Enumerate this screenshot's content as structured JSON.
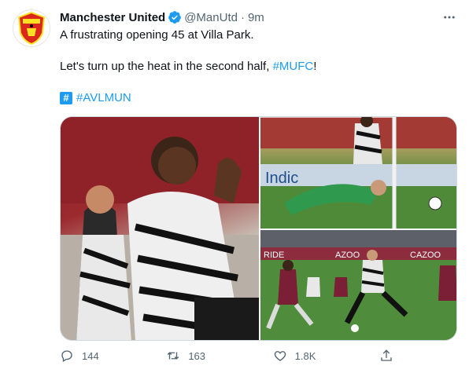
{
  "tweet": {
    "author_name": "Manchester United",
    "handle": "@ManUtd",
    "separator": "·",
    "time": "9m",
    "lines": [
      "A frustrating opening 45 at Villa Park.",
      "Let's turn up the heat in the second half, ",
      "#MUFC",
      "!"
    ],
    "hashflag_text": "#AVLMUN",
    "hashflag_icon": "#"
  },
  "actions": {
    "reply_count": "144",
    "retweet_count": "163",
    "like_count": "1.8K"
  },
  "colors": {
    "link": "#1d9bf0",
    "secondary_text": "#536471",
    "brand_red": "#da291c"
  },
  "photo_texts": {
    "board_indic": "Indic",
    "board_ride": "RIDE",
    "board_azoo": "AZOO",
    "board_cazoo": "CAZOO"
  }
}
